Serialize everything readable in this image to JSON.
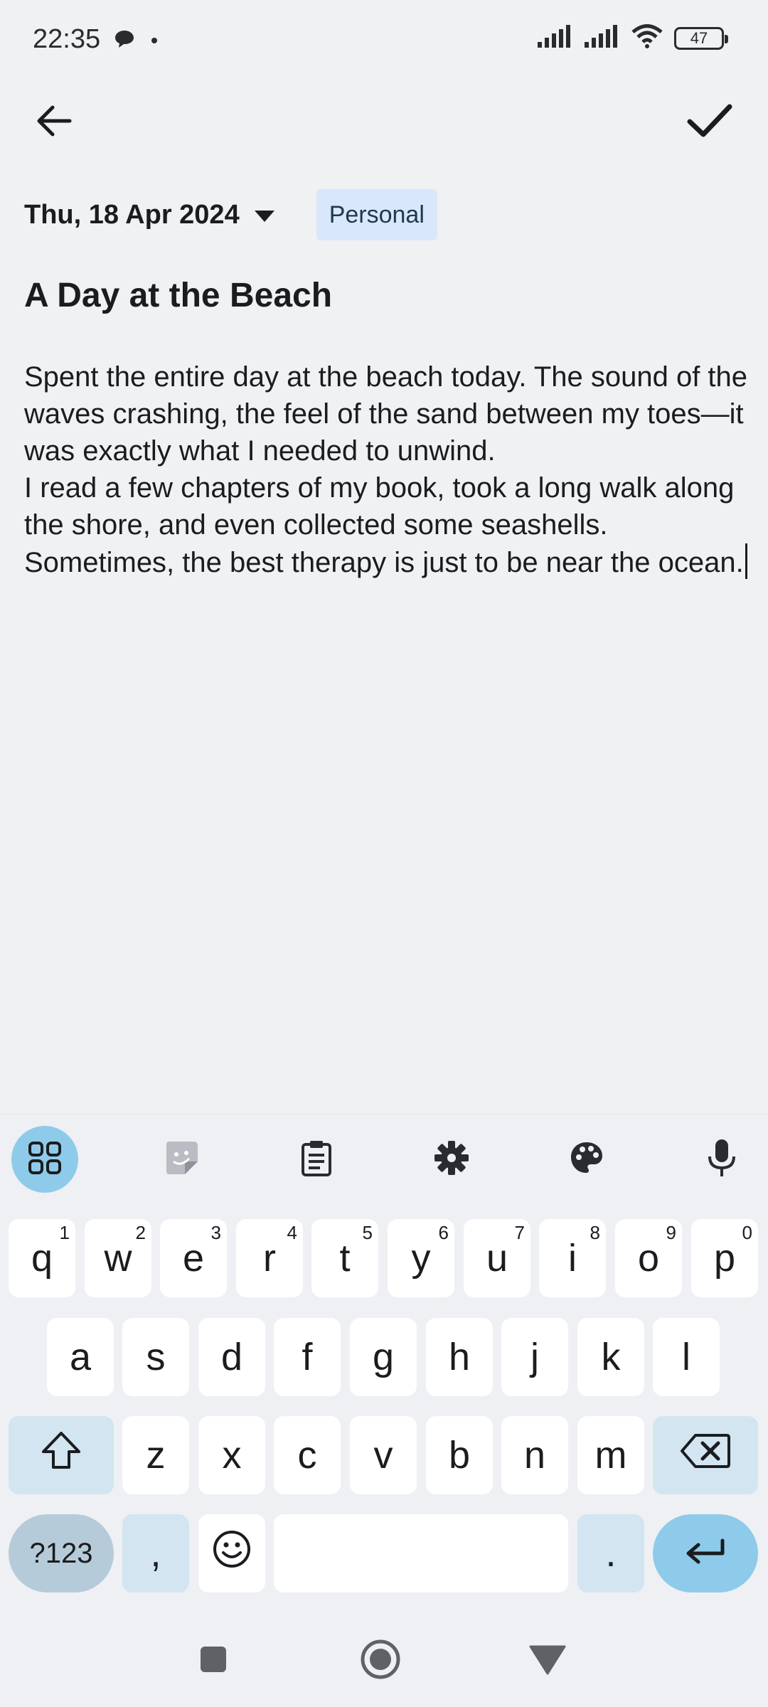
{
  "status_bar": {
    "time": "22:35",
    "battery": "47",
    "icons": [
      "chat-bubble-icon",
      "dot-icon",
      "signal-icon",
      "signal-icon",
      "wifi-icon",
      "battery-icon"
    ]
  },
  "topbar": {
    "back_icon": "arrow-left-icon",
    "save_icon": "check-icon"
  },
  "note": {
    "date": "Thu, 18 Apr 2024",
    "tag": "Personal",
    "title": "A Day at the Beach",
    "body": "Spent the entire day at the beach today. The sound of the waves crashing, the feel of the sand between my toes—it was exactly what I needed to unwind.\nI read a few chapters of my book, took a long walk along the shore, and even collected some seashells. Sometimes, the best therapy is just to be near the ocean."
  },
  "keyboard": {
    "toolbar": [
      "apps-grid-icon",
      "sticker-icon",
      "clipboard-icon",
      "settings-icon",
      "palette-icon",
      "microphone-icon"
    ],
    "row1": [
      {
        "label": "q",
        "hint": "1"
      },
      {
        "label": "w",
        "hint": "2"
      },
      {
        "label": "e",
        "hint": "3"
      },
      {
        "label": "r",
        "hint": "4"
      },
      {
        "label": "t",
        "hint": "5"
      },
      {
        "label": "y",
        "hint": "6"
      },
      {
        "label": "u",
        "hint": "7"
      },
      {
        "label": "i",
        "hint": "8"
      },
      {
        "label": "o",
        "hint": "9"
      },
      {
        "label": "p",
        "hint": "0"
      }
    ],
    "row2": [
      "a",
      "s",
      "d",
      "f",
      "g",
      "h",
      "j",
      "k",
      "l"
    ],
    "row3": [
      "z",
      "x",
      "c",
      "v",
      "b",
      "n",
      "m"
    ],
    "symbols_label": "?123",
    "comma_label": ",",
    "period_label": "."
  },
  "colors": {
    "accent": "#8ecbea",
    "modifier_key": "#d2e5f1",
    "tag_background": "#d9e7fb",
    "background": "#f0f1f3"
  }
}
